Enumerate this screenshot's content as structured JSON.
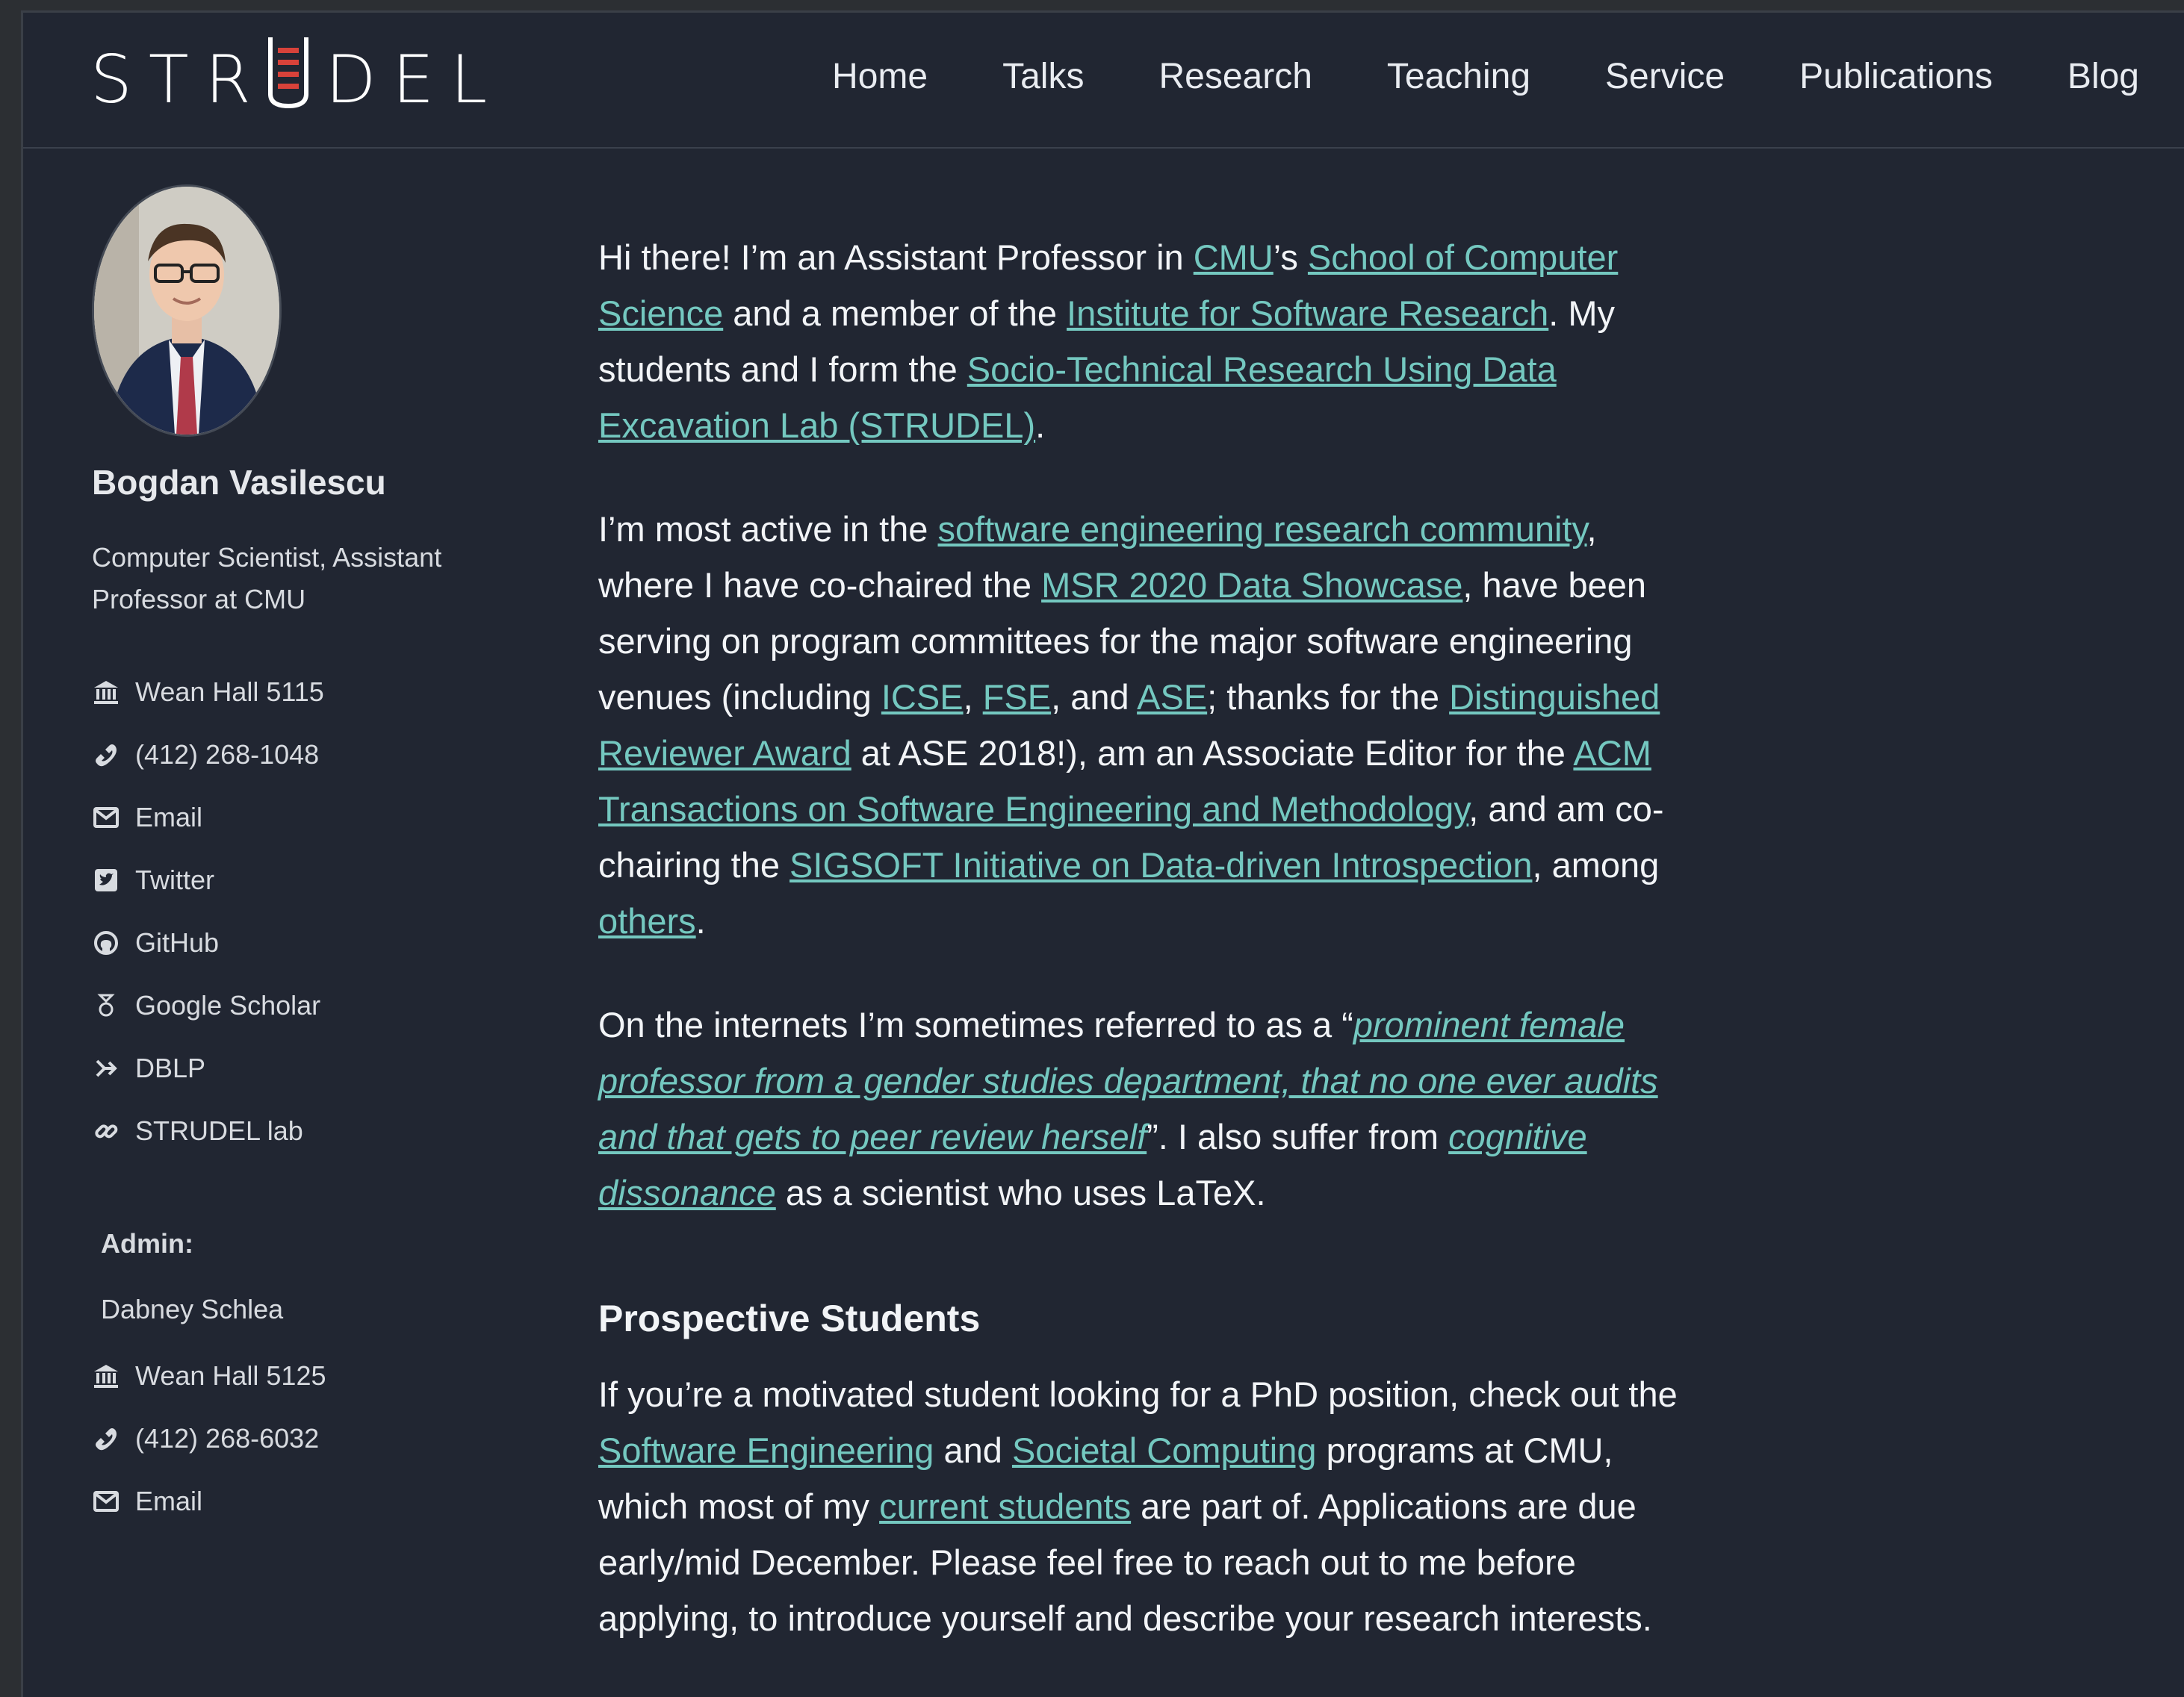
{
  "brand": {
    "name": "STRUDEL"
  },
  "nav": [
    "Home",
    "Talks",
    "Research",
    "Teaching",
    "Service",
    "Publications",
    "Blog"
  ],
  "profile": {
    "name": "Bogdan Vasilescu",
    "bio": "Computer Scientist, Assistant Professor at CMU",
    "links": [
      {
        "icon": "building-icon",
        "label": "Wean Hall 5115"
      },
      {
        "icon": "phone-icon",
        "label": "(412) 268-1048"
      },
      {
        "icon": "envelope-icon",
        "label": "Email"
      },
      {
        "icon": "twitter-icon",
        "label": "Twitter"
      },
      {
        "icon": "github-icon",
        "label": "GitHub"
      },
      {
        "icon": "scholar-icon",
        "label": "Google Scholar"
      },
      {
        "icon": "dblp-icon",
        "label": "DBLP"
      },
      {
        "icon": "link-icon",
        "label": "STRUDEL lab"
      }
    ],
    "admin_title": "Admin:",
    "admin_name": "Dabney Schlea",
    "admin_links": [
      {
        "icon": "building-icon",
        "label": "Wean Hall 5125"
      },
      {
        "icon": "phone-icon",
        "label": "(412) 268-6032"
      },
      {
        "icon": "envelope-icon",
        "label": "Email"
      }
    ]
  },
  "content": {
    "p1": {
      "t1": "Hi there! I’m an Assistant Professor in ",
      "l1": "CMU",
      "t2": "’s ",
      "l2": "School of Computer Science",
      "t3": " and a member of the ",
      "l3": "Institute for Software Research",
      "t4": ". My students and I form the ",
      "l4": "Socio-Technical Research Using Data Excavation Lab (STRUDEL)",
      "t5": "."
    },
    "p2": {
      "t1": "I’m most active in the ",
      "l1": "software engineering research community",
      "t2": ", where I have co-chaired the ",
      "l2": "MSR 2020 Data Showcase",
      "t3": ", have been serving on program committees for the major software engineering venues (including ",
      "l3": "ICSE",
      "t4": ", ",
      "l4": "FSE",
      "t5": ", and ",
      "l5": "ASE",
      "t6": "; thanks for the ",
      "l6": "Distinguished Reviewer Award",
      "t7": " at ASE 2018!), am an Associate Editor for the ",
      "l7": "ACM Transactions on Software Engineering and Methodology",
      "t8": ", and am co-chairing the ",
      "l8": "SIGSOFT Initiative on Data-driven Introspection",
      "t9": ", among ",
      "l9": "others",
      "t10": "."
    },
    "p3": {
      "t1": "On the internets I’m sometimes referred to as a “",
      "l1": "prominent female professor from a gender studies department, that no one ever audits and that gets to peer review herself",
      "t2": "”. I also suffer from ",
      "l2": "cognitive dissonance",
      "t3": " as a scientist who uses LaTeX."
    },
    "heading": "Prospective Students",
    "p4": {
      "t1": "If you’re a motivated student looking for a PhD position, check out the ",
      "l1": "Software Engineering",
      "t2": " and ",
      "l2": "Societal Computing",
      "t3": " programs at CMU, which most of my ",
      "l3": "current students",
      "t4": " are part of. Applications are due early/mid December. Please feel free to reach out to me before applying, to introduce yourself and describe your research interests."
    }
  }
}
